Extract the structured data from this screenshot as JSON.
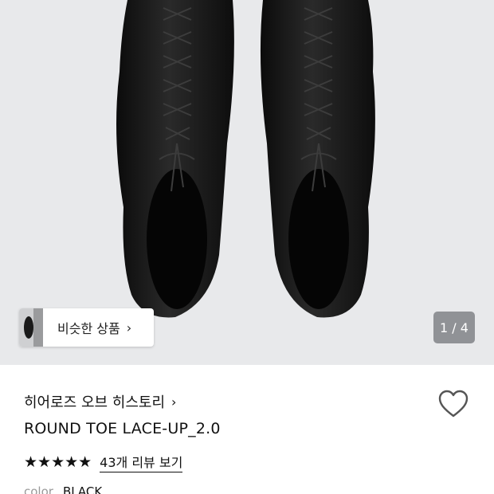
{
  "hero": {
    "similar_products_label": "비슷한 상품",
    "pager_text": "1 / 4"
  },
  "product": {
    "brand": "히어로즈 오브 히스토리",
    "name": "ROUND TOE LACE-UP_2.0",
    "rating_stars": "★★★★★",
    "review_link": "43개 리뷰 보기",
    "color_label": "color",
    "color_value": "BLACK"
  },
  "icons": {
    "chevron": "›",
    "favorite": "heart-outline-icon"
  }
}
